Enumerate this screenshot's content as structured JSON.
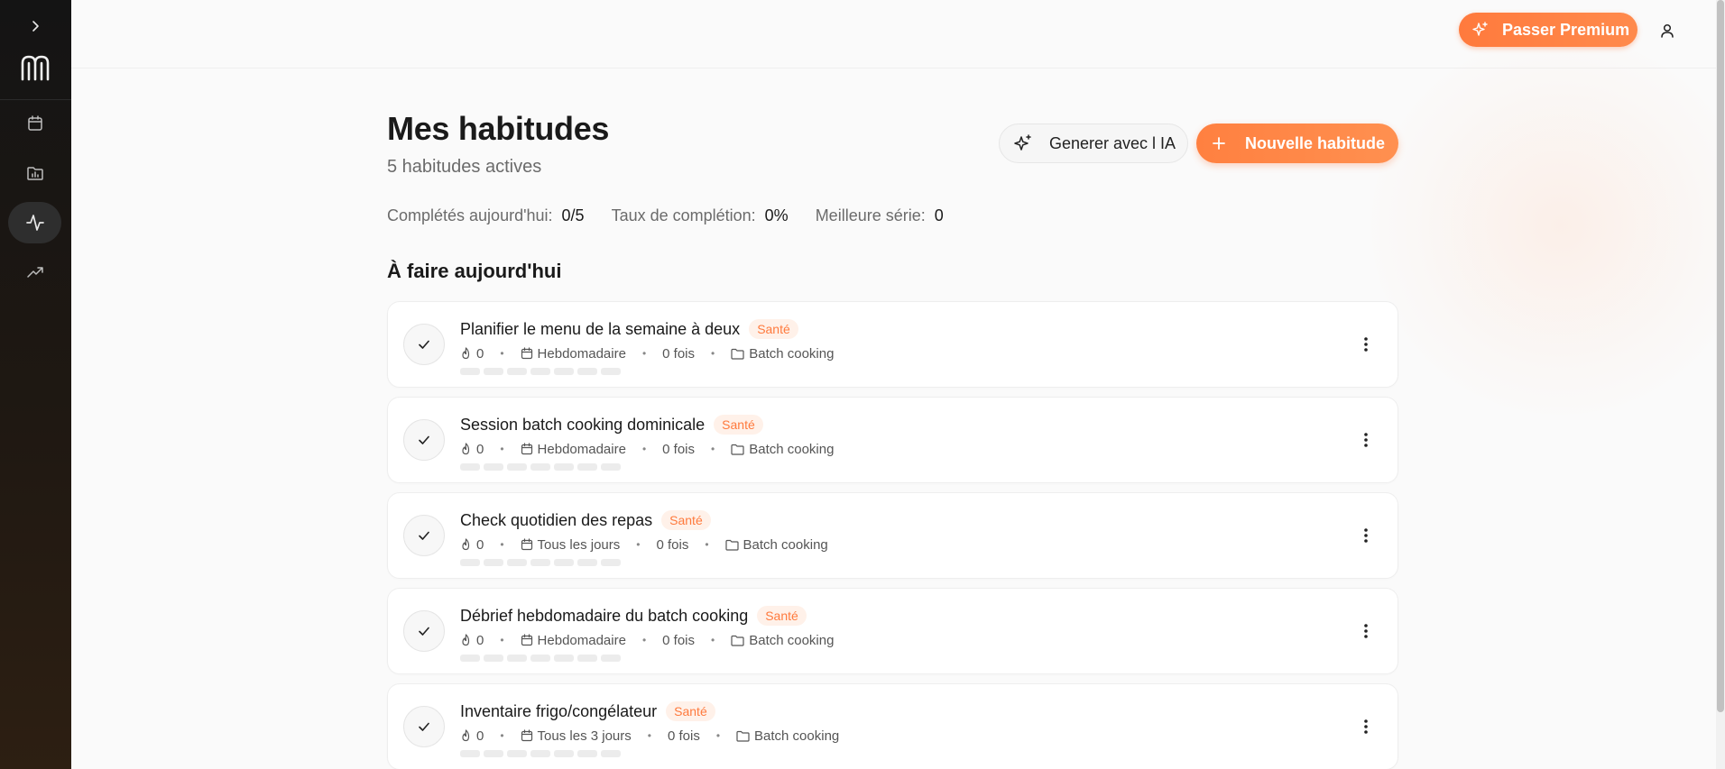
{
  "topbar": {
    "premium_label": "Passer Premium"
  },
  "sidebar": {
    "items": [
      {
        "name": "calendar",
        "active": false
      },
      {
        "name": "folder-chart",
        "active": false
      },
      {
        "name": "activity",
        "active": true
      },
      {
        "name": "trending",
        "active": false
      }
    ]
  },
  "header": {
    "title": "Mes habitudes",
    "subtitle": "5 habitudes actives",
    "ai_button_label": "Generer avec l IA",
    "new_button_label": "Nouvelle habitude"
  },
  "stats": {
    "completed_label": "Complétés aujourd'hui:",
    "completed_value": "0/5",
    "rate_label": "Taux de complétion:",
    "rate_value": "0%",
    "streak_label": "Meilleure série:",
    "streak_value": "0"
  },
  "section_title": "À faire aujourd'hui",
  "habits": [
    {
      "title": "Planifier le menu de la semaine à deux",
      "tag": "Santé",
      "streak": "0",
      "frequency": "Hebdomadaire",
      "count": "0 fois",
      "folder": "Batch cooking"
    },
    {
      "title": "Session batch cooking dominicale",
      "tag": "Santé",
      "streak": "0",
      "frequency": "Hebdomadaire",
      "count": "0 fois",
      "folder": "Batch cooking"
    },
    {
      "title": "Check quotidien des repas",
      "tag": "Santé",
      "streak": "0",
      "frequency": "Tous les jours",
      "count": "0 fois",
      "folder": "Batch cooking"
    },
    {
      "title": "Débrief hebdomadaire du batch cooking",
      "tag": "Santé",
      "streak": "0",
      "frequency": "Hebdomadaire",
      "count": "0 fois",
      "folder": "Batch cooking"
    },
    {
      "title": "Inventaire frigo/congélateur",
      "tag": "Santé",
      "streak": "0",
      "frequency": "Tous les 3 jours",
      "count": "0 fois",
      "folder": "Batch cooking"
    }
  ],
  "colors": {
    "accent": "#ff7a3d",
    "tag_bg": "#fff1e9",
    "sidebar_bg": "#141414"
  }
}
